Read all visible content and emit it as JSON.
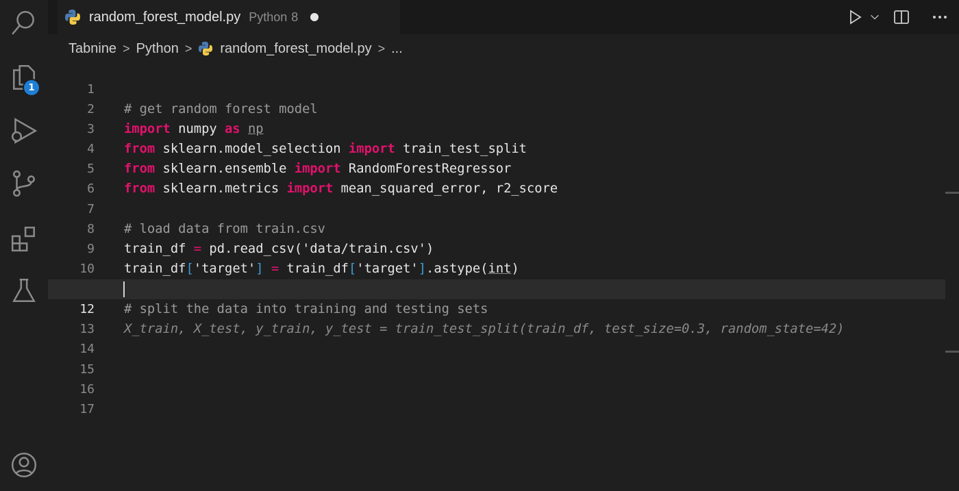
{
  "tab": {
    "title": "random_forest_model.py",
    "language": "Python",
    "problems": "8"
  },
  "breadcrumb": {
    "items": [
      "Tabnine",
      "Python",
      "random_forest_model.py",
      "..."
    ],
    "separator": ">"
  },
  "activity_bar": {
    "icons": [
      "search-icon",
      "explorer-icon",
      "run-debug-icon",
      "source-control-icon",
      "extensions-icon",
      "testing-icon",
      "account-icon"
    ],
    "explorer_badge": "1"
  },
  "editor": {
    "current_line": 12,
    "lines": [
      {
        "n": "1",
        "text": "# get random forest model"
      },
      {
        "n": "2",
        "text": "import numpy as np"
      },
      {
        "n": "3",
        "text": "from sklearn.model_selection import train_test_split"
      },
      {
        "n": "4",
        "text": "from sklearn.ensemble import RandomForestRegressor"
      },
      {
        "n": "5",
        "text": "from sklearn.metrics import mean_squared_error, r2_score"
      },
      {
        "n": "6",
        "text": ""
      },
      {
        "n": "7",
        "text": "# load data from train.csv"
      },
      {
        "n": "8",
        "text": "train_df = pd.read_csv('data/train.csv')"
      },
      {
        "n": "9",
        "text": "train_df['target'] = train_df['target'].astype(int)"
      },
      {
        "n": "10",
        "text": ""
      },
      {
        "n": "11",
        "text": "# split the data into training and testing sets"
      },
      {
        "n": "12",
        "text": "X_train, X_test, y_train, y_test = train_test_split(train_df, test_size=0.3, random_state=42)"
      },
      {
        "n": "13",
        "text": ""
      },
      {
        "n": "14",
        "text": ""
      },
      {
        "n": "15",
        "text": ""
      },
      {
        "n": "16",
        "text": ""
      },
      {
        "n": "17",
        "text": ""
      }
    ]
  },
  "tokens": {
    "l1": "# get random forest model",
    "l2_kw1": "import",
    "l2_a": " numpy ",
    "l2_kw2": "as",
    "l2_b": " ",
    "l2_alias": "np",
    "l3_kw1": "from",
    "l3_a": " sklearn.model_selection ",
    "l3_kw2": "import",
    "l3_b": " train_test_split",
    "l4_kw1": "from",
    "l4_a": " sklearn.ensemble ",
    "l4_kw2": "import",
    "l4_b": " RandomForestRegressor",
    "l5_kw1": "from",
    "l5_a": " sklearn.metrics ",
    "l5_kw2": "import",
    "l5_b": " mean_squared_error, r2_score",
    "l7": "# load data from train.csv",
    "l8_a": "train_df ",
    "l8_op": "=",
    "l8_b": " pd.read_csv('data/train.csv')",
    "l9_a": "train_df",
    "l9_br1": "[",
    "l9_b": "'target'",
    "l9_br2": "]",
    "l9_c": " ",
    "l9_op": "=",
    "l9_d": " train_df",
    "l9_br3": "[",
    "l9_e": "'target'",
    "l9_br4": "]",
    "l9_f": ".astype(",
    "l9_int": "int",
    "l9_g": ")",
    "l11": "# split the data into training and testing sets",
    "l12_ghost": "X_train, X_test, y_train, y_test = train_test_split(train_df, test_size=0.3, random_state=42)"
  },
  "colors": {
    "background": "#1f1f1f",
    "keyword": "#e3116c",
    "comment": "#9b9b9b",
    "bracket": "#3e9ad6",
    "badge": "#1f7fd6"
  }
}
